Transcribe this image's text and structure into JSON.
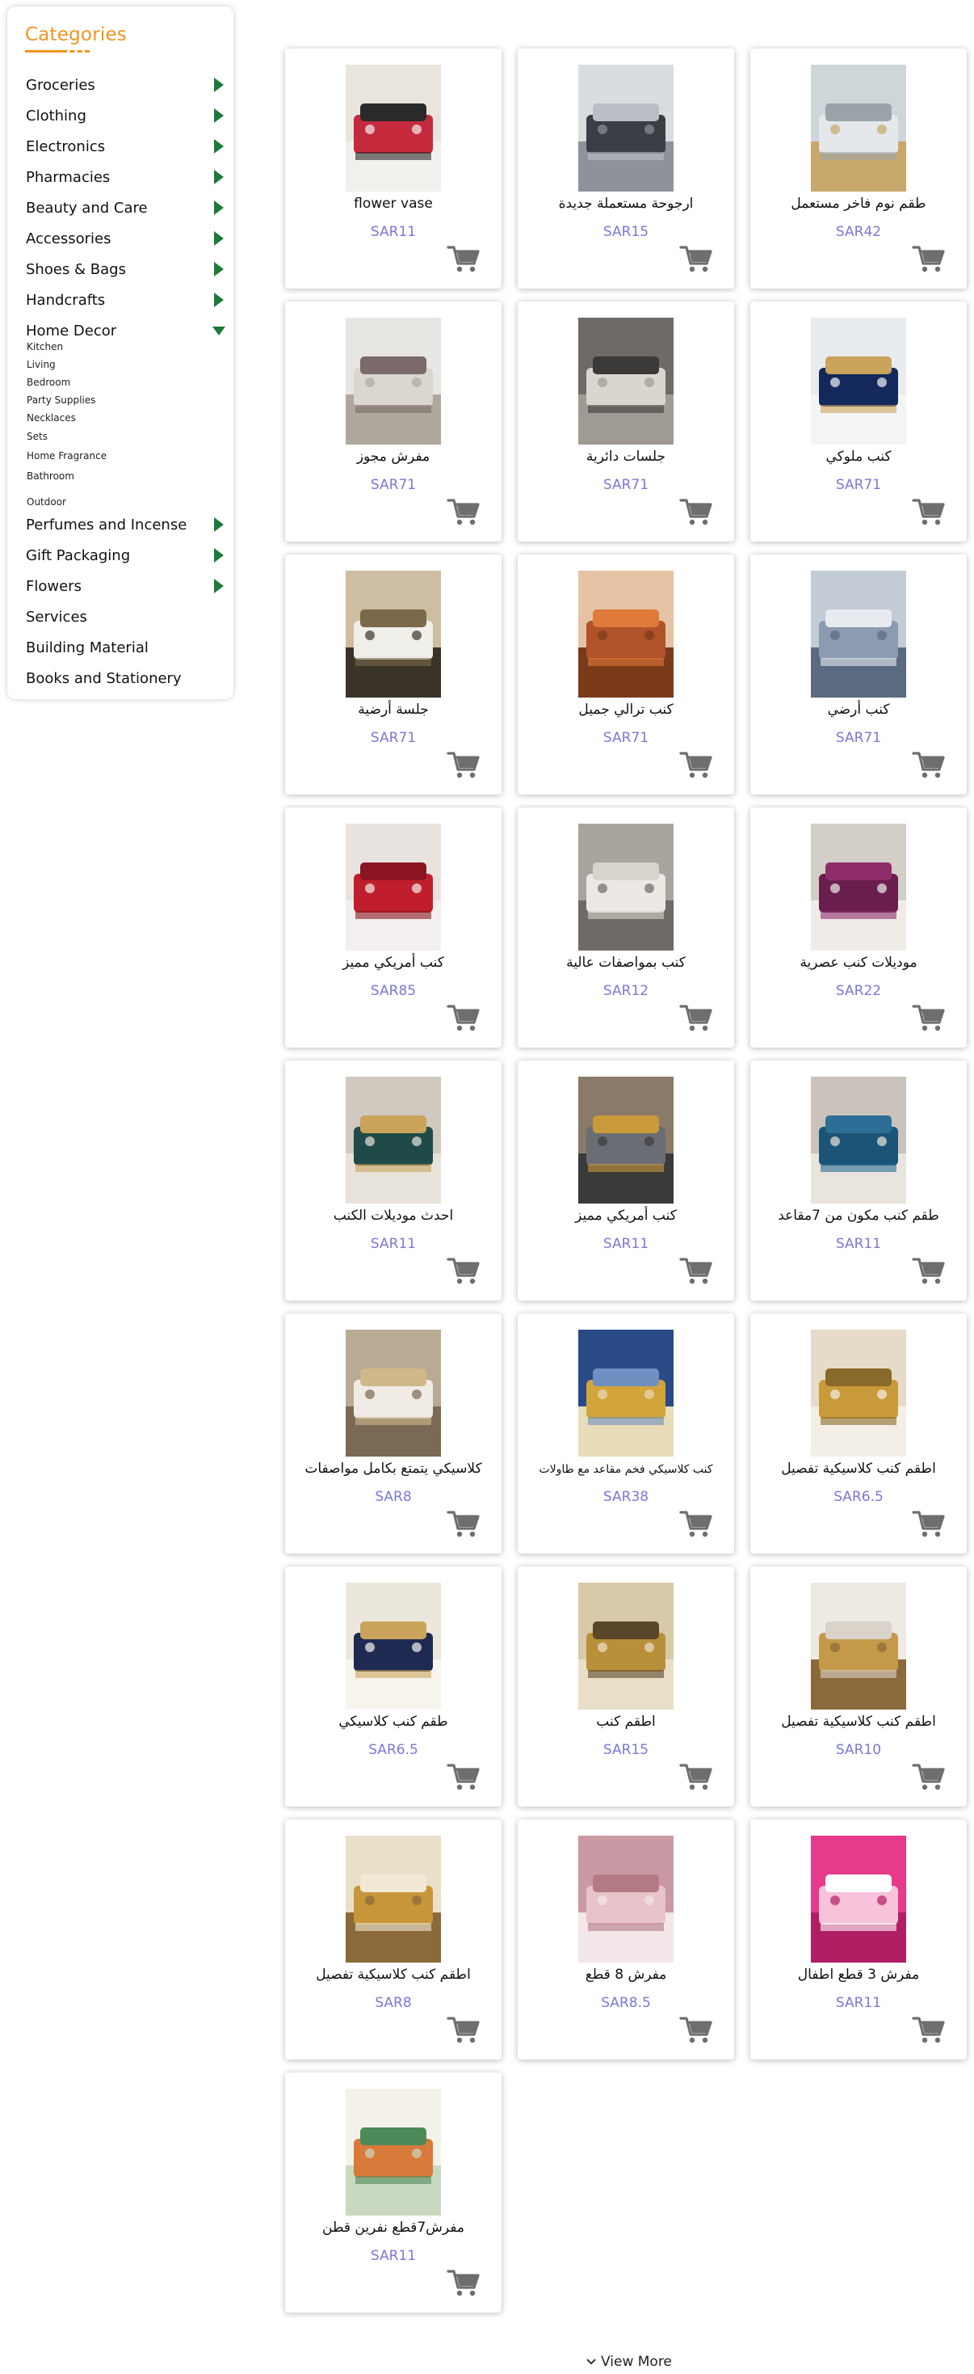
{
  "sidebar": {
    "title": "Categories",
    "accent_color": "#f29421",
    "arrow_color": "#1e7a3a",
    "categories": [
      {
        "label": "Groceries",
        "arrow": "right"
      },
      {
        "label": "Clothing",
        "arrow": "right"
      },
      {
        "label": "Electronics",
        "arrow": "right"
      },
      {
        "label": "Pharmacies",
        "arrow": "right"
      },
      {
        "label": "Beauty and Care",
        "arrow": "right"
      },
      {
        "label": "Accessories",
        "arrow": "right"
      },
      {
        "label": "Shoes & Bags",
        "arrow": "right"
      },
      {
        "label": "Handcrafts",
        "arrow": "right"
      },
      {
        "label": "Home Decor",
        "arrow": "down"
      },
      {
        "label": "Perfumes and Incense",
        "arrow": "right"
      },
      {
        "label": "Gift Packaging",
        "arrow": "right"
      },
      {
        "label": "Flowers",
        "arrow": "right"
      },
      {
        "label": "Services",
        "arrow": "none"
      },
      {
        "label": "Building Material",
        "arrow": "none"
      },
      {
        "label": "Books and Stationery",
        "arrow": "none"
      }
    ],
    "home_decor_sub": [
      "Kitchen",
      "Living",
      "Bedroom",
      "Party Supplies",
      "Necklaces",
      "Sets",
      "Home Fragrance",
      "Bathroom",
      "Outdoor"
    ]
  },
  "price_color": "#7b78d8",
  "cart_icon": "shopping-cart-icon",
  "products": [
    {
      "name": "flower vase",
      "price": "SAR11",
      "image": "vase"
    },
    {
      "name": "ارجوحة مستعملة جديدة",
      "price": "SAR15",
      "image": "swing"
    },
    {
      "name": "طقم نوم فاخر مستعمل",
      "price": "SAR42",
      "image": "bed"
    },
    {
      "name": "مفرش مجوز",
      "price": "SAR71",
      "image": "duvet"
    },
    {
      "name": "جلسات دائرية",
      "price": "SAR71",
      "image": "round-seating"
    },
    {
      "name": "كنب ملوكي",
      "price": "SAR71",
      "image": "royal-sofa"
    },
    {
      "name": "جلسة أرضية",
      "price": "SAR71",
      "image": "floor-seating"
    },
    {
      "name": "كنب ترالي جميل",
      "price": "SAR71",
      "image": "wood-sofa"
    },
    {
      "name": "كنب أرضي",
      "price": "SAR71",
      "image": "floor-sofa"
    },
    {
      "name": "كنب أمريكي مميز",
      "price": "SAR85",
      "image": "red-sofa"
    },
    {
      "name": "كنب بمواصفات عالية",
      "price": "SAR12",
      "image": "white-sofa"
    },
    {
      "name": "موديلات كنب عصرية",
      "price": "SAR22",
      "image": "purple-sofa"
    },
    {
      "name": "احدث موديلات الكنب",
      "price": "SAR11",
      "image": "green-sofa"
    },
    {
      "name": "كنب أمريكي مميز",
      "price": "SAR11",
      "image": "gold-chair"
    },
    {
      "name": "طقم كنب مكون من 7مقاعد",
      "price": "SAR11",
      "image": "teal-sofa"
    },
    {
      "name": "كلاسيكي يتمتع بكامل مواصفات",
      "price": "SAR8",
      "image": "showroom"
    },
    {
      "name": "كنب كلاسيكي فخم مقاعد مع طاولات",
      "price": "SAR38",
      "image": "blue-classic",
      "small": true
    },
    {
      "name": "اطقم كنب كلاسيكية تفصيل",
      "price": "SAR6.5",
      "image": "gold-table"
    },
    {
      "name": "طقم كنب كلاسيكي",
      "price": "SAR6.5",
      "image": "navy-classic"
    },
    {
      "name": "اطقم كنب",
      "price": "SAR15",
      "image": "gold-set"
    },
    {
      "name": "اطقم كنب كلاسيكية تفصيل",
      "price": "SAR10",
      "image": "white-gold"
    },
    {
      "name": "اطقم كنب كلاسيكية تفصيل",
      "price": "SAR8",
      "image": "cream-gold"
    },
    {
      "name": "مفرش 8 قطع",
      "price": "SAR8.5",
      "image": "pink-bed"
    },
    {
      "name": "مفرش 3 قطع اطفال",
      "price": "SAR11",
      "image": "kids-bed"
    },
    {
      "name": "مفرش7قطع نفرين قطن",
      "price": "SAR11",
      "image": "floral-bed"
    }
  ],
  "view_more": "View More"
}
